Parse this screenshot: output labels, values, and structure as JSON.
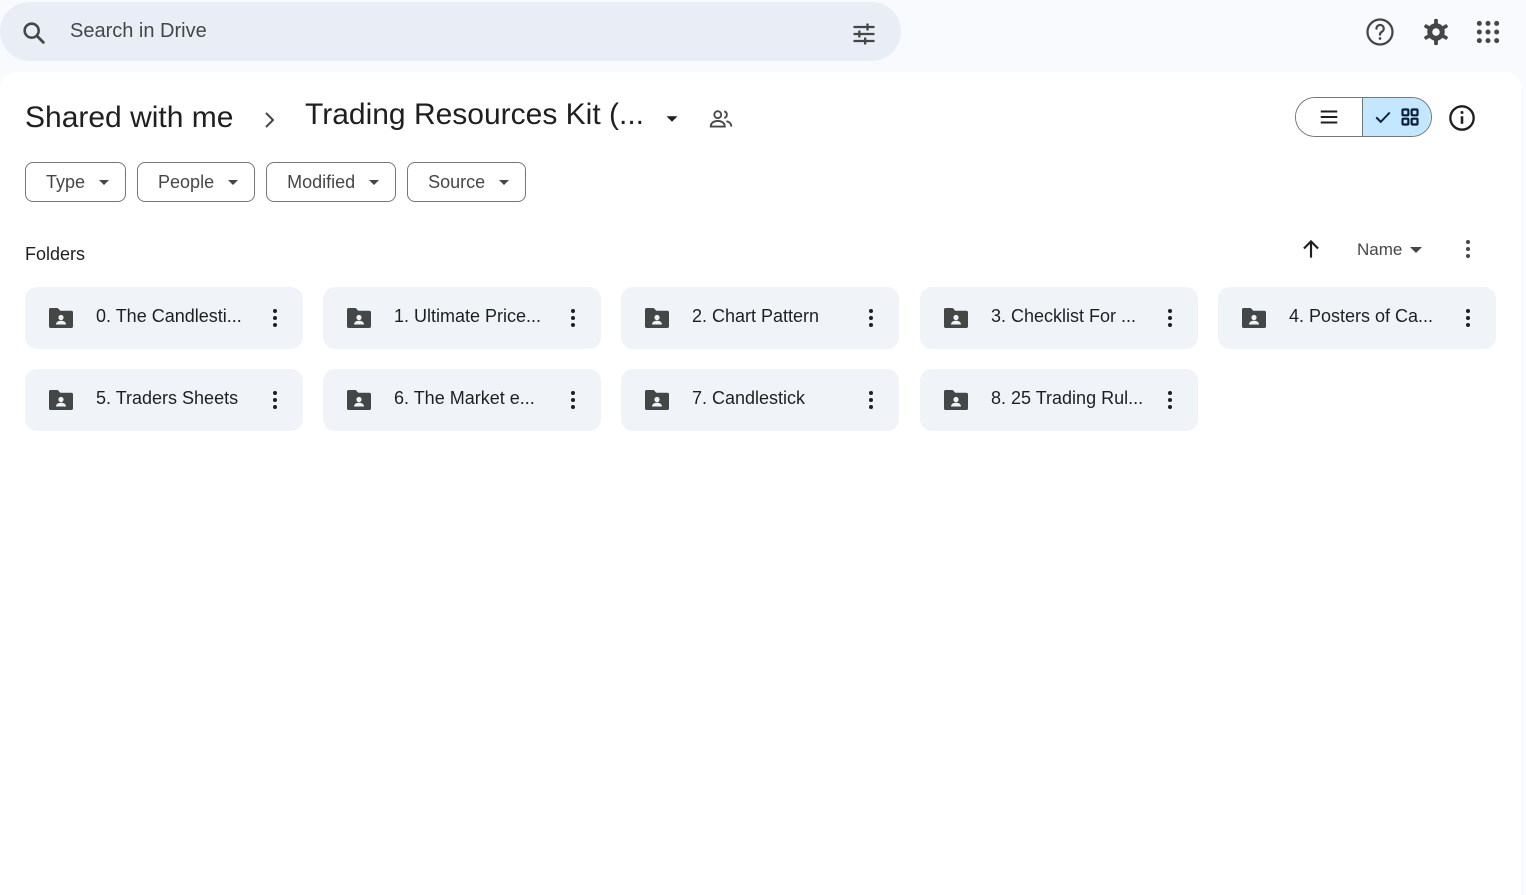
{
  "search": {
    "placeholder": "Search in Drive"
  },
  "icons": {
    "search": "search-icon",
    "tune": "tune-icon",
    "help": "help-icon",
    "settings": "gear-icon",
    "apps": "apps-grid-icon"
  },
  "breadcrumb": {
    "root": "Shared with me",
    "current": "Trading Resources Kit (..."
  },
  "filters": [
    {
      "label": "Type"
    },
    {
      "label": "People"
    },
    {
      "label": "Modified"
    },
    {
      "label": "Source"
    }
  ],
  "section": {
    "title": "Folders"
  },
  "sort": {
    "field": "Name",
    "direction": "ascending"
  },
  "folders": [
    {
      "name": "0. The Candlesti..."
    },
    {
      "name": "1. Ultimate Price..."
    },
    {
      "name": "2. Chart Pattern"
    },
    {
      "name": "3. Checklist For ..."
    },
    {
      "name": "4. Posters of Ca..."
    },
    {
      "name": "5. Traders Sheets"
    },
    {
      "name": "6. The Market e..."
    },
    {
      "name": "7. Candlestick"
    },
    {
      "name": "8. 25 Trading Rul..."
    }
  ],
  "colors": {
    "background": "#f8fafd",
    "search_bg": "#e9eef6",
    "card_bg": "#f0f4f9",
    "selected_toggle": "#c2e7ff",
    "icon": "#444746"
  }
}
